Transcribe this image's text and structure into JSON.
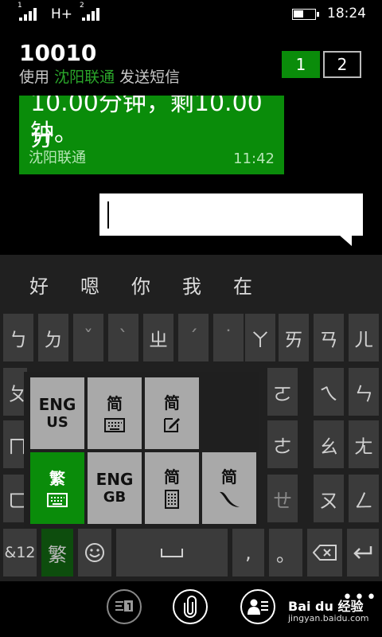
{
  "status_bar": {
    "sim1_marker": "1",
    "network": "H+",
    "sim2_marker": "2",
    "time": "18:24"
  },
  "header": {
    "title": "10010",
    "subtitle_prefix": "使用",
    "subtitle_carrier": "沈阳联通",
    "subtitle_suffix": "发送短信",
    "sim_tab_1": "1",
    "sim_tab_2": "2"
  },
  "message": {
    "cut_off_text": "10.00分钟，剩10.00分",
    "text": "钟。",
    "sender": "沈阳联通",
    "time": "11:42"
  },
  "keyboard": {
    "candidates": [
      "好",
      "嗯",
      "你",
      "我",
      "在"
    ],
    "row1": [
      "ㄅ",
      "ㄉ",
      "ˇ",
      "ˋ",
      "ㄓ",
      "ˊ",
      "˙",
      "ㄚ",
      "ㄞ",
      "ㄢ",
      "ㄦ"
    ],
    "row2_visible": [
      "ㄆ",
      "ㄛ",
      "ㄟ",
      "ㄣ"
    ],
    "row3_visible": [
      "ㄇ",
      "ㄜ",
      "ㄠ",
      "ㄤ"
    ],
    "row4_visible": [
      "ㄈ",
      "ㄝ",
      "ㄡ",
      "ㄥ"
    ],
    "bottom_row": {
      "numeric": "&12",
      "lang": "繁",
      "comma": ",",
      "period": "。"
    },
    "language_popup": {
      "eng_us_line1": "ENG",
      "eng_us_line2": "US",
      "simplified_kb": "简",
      "simplified_handwriting": "简",
      "traditional": "繁",
      "eng_gb_line1": "ENG",
      "eng_gb_line2": "GB",
      "simplified_numpad": "简",
      "simplified_stroke": "简"
    }
  },
  "watermark": {
    "brand": "Bai du 经验",
    "url": "jingyan.baidu.com"
  },
  "colors": {
    "accent": "#0a8c0a",
    "keyboard_bg": "#202020",
    "key_bg": "#3b3b3b",
    "popup_key_bg": "#a9a9a9"
  },
  "icons": [
    "signal-icon",
    "keyboard-icon",
    "pencil-icon",
    "numpad-icon",
    "stroke-icon",
    "emoji-icon",
    "space-icon",
    "backspace-icon",
    "enter-icon",
    "sim-switch-icon",
    "attach-icon",
    "contact-icon",
    "more-icon"
  ]
}
